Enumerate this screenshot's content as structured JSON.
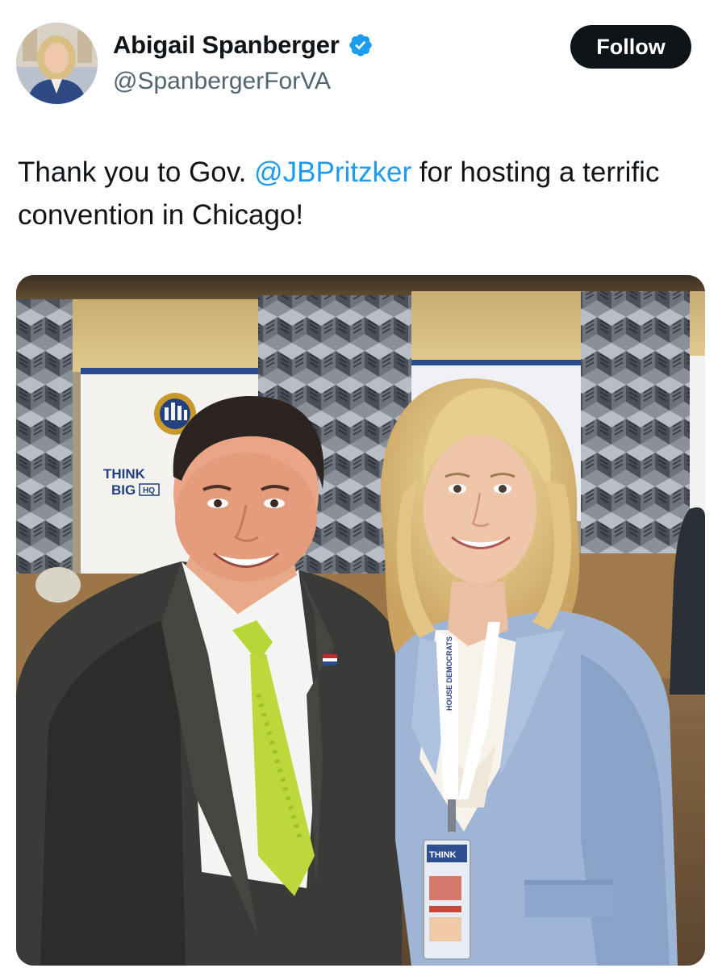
{
  "tweet": {
    "author": {
      "display_name": "Abigail Spanberger",
      "handle": "@SpanbergerForVA",
      "verified": true,
      "avatar_icon": "profile-photo"
    },
    "follow_label": "Follow",
    "text": {
      "part1": "Thank you to Gov. ",
      "mention": "@JBPritzker",
      "part2": " for hosting a terrific convention in Chicago!"
    },
    "photo": {
      "banner_text_line1": "THINK",
      "banner_text_line2": "BIG",
      "banner_badge": "HQ",
      "lanyard_text": "HOUSE DEMOCRATS",
      "badge_text": "THINK"
    }
  },
  "colors": {
    "accent": "#1d9bf0",
    "follow_bg": "#0f1419",
    "text": "#0f1419",
    "secondary_text": "#536471"
  }
}
